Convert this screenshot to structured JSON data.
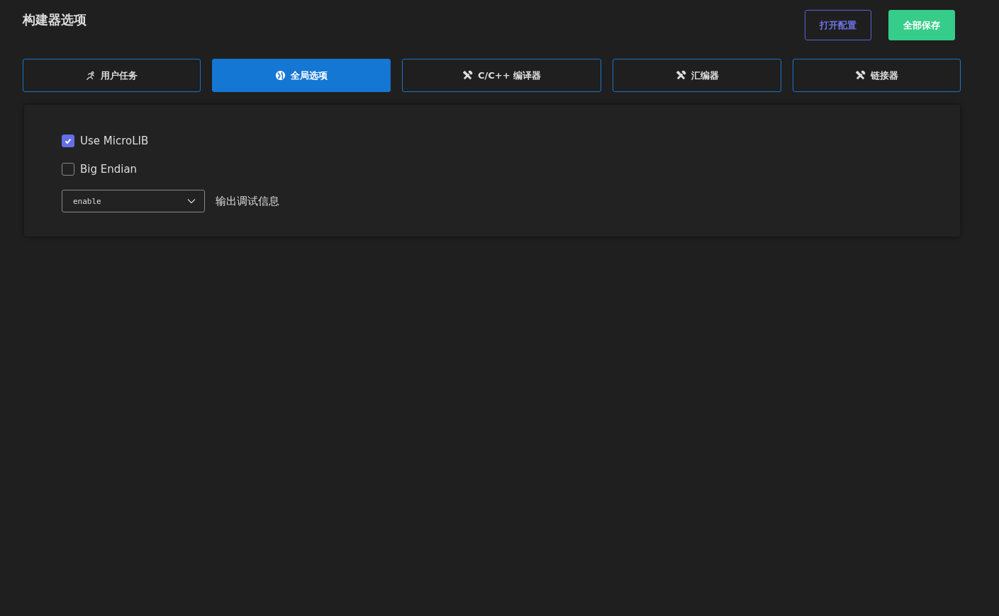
{
  "title": "构建器选项",
  "actions": [
    {
      "label": "打开配置",
      "kind": "outline"
    },
    {
      "label": "全部保存",
      "kind": "primary"
    }
  ],
  "tabs": [
    {
      "label": "用户任务",
      "kind": "run",
      "selected": false
    },
    {
      "label": "全局选项",
      "kind": "globe",
      "selected": true
    },
    {
      "label": "C/C++ 编译器",
      "kind": "tools",
      "selected": false
    },
    {
      "label": "汇编器",
      "kind": "tools",
      "selected": false
    },
    {
      "label": "链接器",
      "kind": "tools",
      "selected": false
    }
  ],
  "options": [
    {
      "label": "Use MicroLIB",
      "checked": true
    },
    {
      "label": "Big Endian",
      "checked": false
    }
  ],
  "select": {
    "value": "enable",
    "label": "输出调试信息"
  }
}
